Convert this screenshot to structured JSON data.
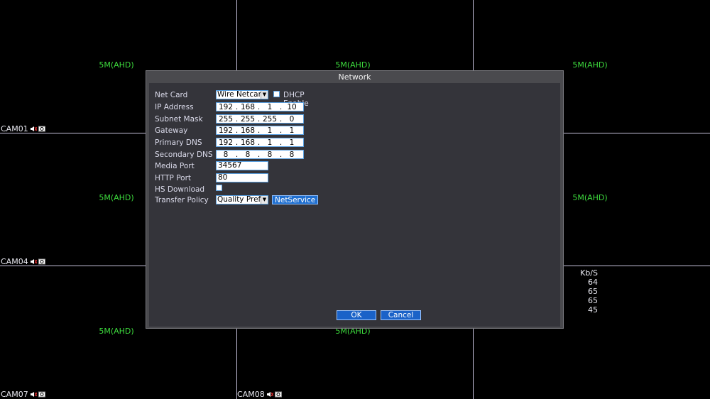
{
  "grid": {
    "channels": [
      {
        "res": "5M(AHD)",
        "cam": "CAM01"
      },
      {
        "res": "5M(AHD)",
        "cam": ""
      },
      {
        "res": "5M(AHD)",
        "cam": ""
      },
      {
        "res": "5M(AHD)",
        "cam": "CAM04"
      },
      {
        "res": "",
        "cam": ""
      },
      {
        "res": "5M(AHD)",
        "cam": ""
      },
      {
        "res": "5M(AHD)",
        "cam": "CAM07"
      },
      {
        "res": "5M(AHD)",
        "cam": "CAM08"
      },
      {
        "res": "",
        "cam": ""
      }
    ],
    "kbs_header": "Kb/S",
    "kbs_values": [
      "64",
      "65",
      "65",
      "45"
    ]
  },
  "dialog": {
    "title": "Network",
    "net_card": {
      "label": "Net Card",
      "value": "Wire Netcard"
    },
    "dhcp": {
      "label": "DHCP Enable",
      "checked": false
    },
    "ip_address": {
      "label": "IP Address",
      "octets": [
        "192",
        "168",
        "1",
        "10"
      ]
    },
    "subnet_mask": {
      "label": "Subnet Mask",
      "octets": [
        "255",
        "255",
        "255",
        "0"
      ]
    },
    "gateway": {
      "label": "Gateway",
      "octets": [
        "192",
        "168",
        "1",
        "1"
      ]
    },
    "primary_dns": {
      "label": "Primary DNS",
      "octets": [
        "192",
        "168",
        "1",
        "1"
      ]
    },
    "secondary_dns": {
      "label": "Secondary DNS",
      "octets": [
        "8",
        "8",
        "8",
        "8"
      ]
    },
    "media_port": {
      "label": "Media Port",
      "value": "34567"
    },
    "http_port": {
      "label": "HTTP Port",
      "value": "80"
    },
    "hs_download": {
      "label": "HS Download",
      "checked": false
    },
    "transfer_policy": {
      "label": "Transfer Policy",
      "value": "Quality Prefe"
    },
    "netservice_label": "NetService",
    "ok_label": "OK",
    "cancel_label": "Cancel"
  }
}
